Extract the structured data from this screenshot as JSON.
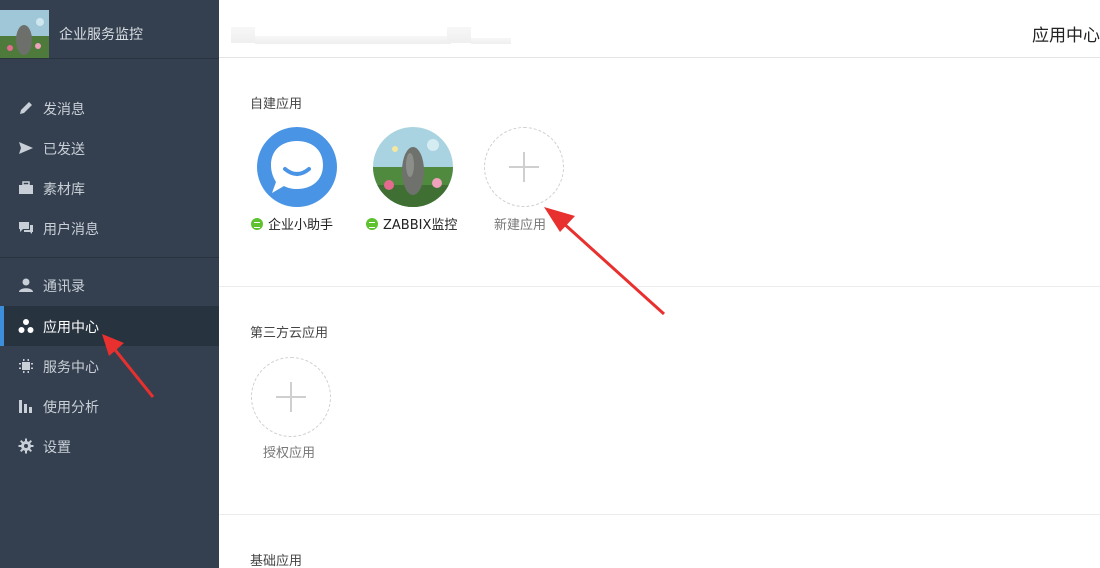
{
  "brand": {
    "name": "企业服务监控"
  },
  "page_title": "应用中心",
  "sidebar": {
    "items": [
      {
        "label": "发消息",
        "icon": "pencil-icon"
      },
      {
        "label": "已发送",
        "icon": "send-icon"
      },
      {
        "label": "素材库",
        "icon": "briefcase-icon"
      },
      {
        "label": "用户消息",
        "icon": "chat-icon"
      },
      {
        "label": "通讯录",
        "icon": "user-icon"
      },
      {
        "label": "应用中心",
        "icon": "apps-icon",
        "active": true
      },
      {
        "label": "服务中心",
        "icon": "chip-icon"
      },
      {
        "label": "使用分析",
        "icon": "bar-chart-icon"
      },
      {
        "label": "设置",
        "icon": "gear-icon"
      }
    ]
  },
  "sections": {
    "custom": {
      "title": "自建应用",
      "apps": [
        {
          "label": "企业小助手",
          "icon": "chat-bubble-icon",
          "status": "active"
        },
        {
          "label": "ZABBIX监控",
          "icon": "photo-avatar",
          "status": "active"
        }
      ],
      "add_label": "新建应用"
    },
    "third_party": {
      "title": "第三方云应用",
      "add_label": "授权应用"
    },
    "basic": {
      "title": "基础应用"
    }
  },
  "colors": {
    "sidebar_bg": "#34404f",
    "sidebar_active_bg": "#283340",
    "active_indicator": "#3d8eda",
    "assistant_blue": "#4a94e6",
    "status_green": "#5ec22f",
    "annotation_red": "#e8302e"
  }
}
